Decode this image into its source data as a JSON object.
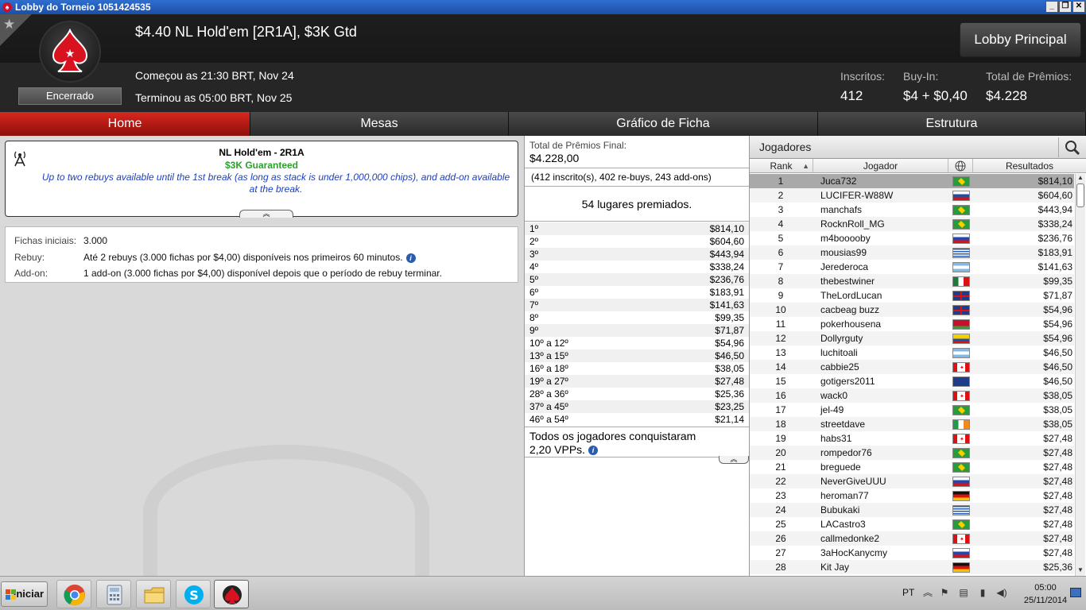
{
  "window": {
    "title": "Lobby do Torneio 1051424535"
  },
  "header": {
    "title": "$4.40 NL Hold'em [2R1A], $3K Gtd",
    "status": "Encerrado",
    "started": "Começou as 21:30 BRT, Nov 24",
    "ended": "Terminou as 05:00 BRT, Nov 25",
    "lobby_button": "Lobby Principal",
    "stats": [
      {
        "label": "Inscritos:",
        "value": "412"
      },
      {
        "label": "Buy-In:",
        "value": "$4 + $0,40"
      },
      {
        "label": "Total de Prêmios:",
        "value": "$4.228"
      }
    ]
  },
  "tabs": [
    "Home",
    "Mesas",
    "Gráfico de Ficha",
    "Estrutura"
  ],
  "info": {
    "title": "NL Hold'em - 2R1A",
    "guarantee": "$3K Guaranteed",
    "description": "Up to two rebuys available until the 1st break (as long as stack is under 1,000,000 chips), and add-on available at the break."
  },
  "details": [
    {
      "label": "Fichas iniciais:",
      "value": "3.000"
    },
    {
      "label": "Rebuy:",
      "value": "Até 2 rebuys (3.000 fichas por $4,00) disponíveis nos primeiros 60 minutos."
    },
    {
      "label": "Add-on:",
      "value": "1 add-on (3.000 fichas por $4,00) disponível depois que o período de rebuy terminar."
    }
  ],
  "prizes": {
    "total_label": "Total de Prêmios Final:",
    "total": "$4.228,00",
    "entries": "(412 inscrito(s), 402 re-buys, 243 add-ons)",
    "places": "54 lugares premiados.",
    "list": [
      {
        "place": "1º",
        "amount": "$814,10"
      },
      {
        "place": "2º",
        "amount": "$604,60"
      },
      {
        "place": "3º",
        "amount": "$443,94"
      },
      {
        "place": "4º",
        "amount": "$338,24"
      },
      {
        "place": "5º",
        "amount": "$236,76"
      },
      {
        "place": "6º",
        "amount": "$183,91"
      },
      {
        "place": "7º",
        "amount": "$141,63"
      },
      {
        "place": "8º",
        "amount": "$99,35"
      },
      {
        "place": "9º",
        "amount": "$71,87"
      },
      {
        "place": "10º a 12º",
        "amount": "$54,96"
      },
      {
        "place": "13º a 15º",
        "amount": "$46,50"
      },
      {
        "place": "16º a 18º",
        "amount": "$38,05"
      },
      {
        "place": "19º a 27º",
        "amount": "$27,48"
      },
      {
        "place": "28º a 36º",
        "amount": "$25,36"
      },
      {
        "place": "37º a 45º",
        "amount": "$23,25"
      },
      {
        "place": "46º a 54º",
        "amount": "$21,14"
      }
    ],
    "vpp": "Todos os jogadores conquistaram 2,20 VPPs."
  },
  "players": {
    "title": "Jogadores",
    "columns": [
      "Rank",
      "Jogador",
      "Resultados"
    ],
    "rows": [
      {
        "rank": "1",
        "name": "Juca732",
        "flag": "brazil",
        "result": "$814,10"
      },
      {
        "rank": "2",
        "name": "LUCIFER-W88W",
        "flag": "slovakia",
        "result": "$604,60"
      },
      {
        "rank": "3",
        "name": "manchafs",
        "flag": "brazil",
        "result": "$443,94"
      },
      {
        "rank": "4",
        "name": "RocknRoll_MG",
        "flag": "brazil",
        "result": "$338,24"
      },
      {
        "rank": "5",
        "name": "m4booooby",
        "flag": "russia",
        "result": "$236,76"
      },
      {
        "rank": "6",
        "name": "mousias99",
        "flag": "greece",
        "result": "$183,91"
      },
      {
        "rank": "7",
        "name": "Jerederoca",
        "flag": "argentina",
        "result": "$141,63"
      },
      {
        "rank": "8",
        "name": "thebestwiner",
        "flag": "mexico",
        "result": "$99,35"
      },
      {
        "rank": "9",
        "name": "TheLordLucan",
        "flag": "uk",
        "result": "$71,87"
      },
      {
        "rank": "10",
        "name": "cacbeag buzz",
        "flag": "uk",
        "result": "$54,96"
      },
      {
        "rank": "11",
        "name": "pokerhousena",
        "flag": "belarus",
        "result": "$54,96"
      },
      {
        "rank": "12",
        "name": "Dollyrguty",
        "flag": "colombia",
        "result": "$54,96"
      },
      {
        "rank": "13",
        "name": "luchitoali",
        "flag": "argentina",
        "result": "$46,50"
      },
      {
        "rank": "14",
        "name": "cabbie25",
        "flag": "canada",
        "result": "$46,50"
      },
      {
        "rank": "15",
        "name": "gotigers2011",
        "flag": "australia",
        "result": "$46,50"
      },
      {
        "rank": "16",
        "name": "wack0",
        "flag": "canada",
        "result": "$38,05"
      },
      {
        "rank": "17",
        "name": "jel-49",
        "flag": "brazil",
        "result": "$38,05"
      },
      {
        "rank": "18",
        "name": "streetdave",
        "flag": "ireland",
        "result": "$38,05"
      },
      {
        "rank": "19",
        "name": "habs31",
        "flag": "canada",
        "result": "$27,48"
      },
      {
        "rank": "20",
        "name": "rompedor76",
        "flag": "brazil",
        "result": "$27,48"
      },
      {
        "rank": "21",
        "name": "breguede",
        "flag": "brazil",
        "result": "$27,48"
      },
      {
        "rank": "22",
        "name": "NeverGiveUUU",
        "flag": "russia",
        "result": "$27,48"
      },
      {
        "rank": "23",
        "name": "heroman77",
        "flag": "germany",
        "result": "$27,48"
      },
      {
        "rank": "24",
        "name": "Bubukaki",
        "flag": "greece",
        "result": "$27,48"
      },
      {
        "rank": "25",
        "name": "LACastro3",
        "flag": "brazil",
        "result": "$27,48"
      },
      {
        "rank": "26",
        "name": "callmedonke2",
        "flag": "canada",
        "result": "$27,48"
      },
      {
        "rank": "27",
        "name": "3aHocKanycmy",
        "flag": "russia",
        "result": "$27,48"
      },
      {
        "rank": "28",
        "name": "Kit Jay",
        "flag": "germany",
        "result": "$25,36"
      }
    ]
  },
  "taskbar": {
    "start": "Iniciar",
    "apps": [
      "chrome-icon",
      "calculator-icon",
      "folder-icon",
      "skype-icon",
      "pokerstars-icon"
    ],
    "lang": "PT",
    "time": "05:00",
    "date": "25/11/2014"
  },
  "colors": {
    "accent_red": "#c8102e",
    "guarantee_green": "#2aa02a",
    "description_blue": "#1d3fbf"
  }
}
